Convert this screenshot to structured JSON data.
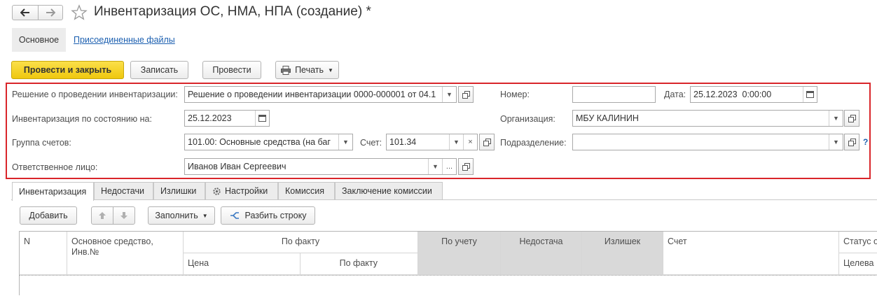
{
  "window": {
    "title": "Инвентаризация ОС, НМА, НПА (создание) *"
  },
  "nav": {
    "back_icon": "arrow-left-icon",
    "forward_icon": "arrow-right-icon",
    "favorite_icon": "star-icon"
  },
  "sections": {
    "main": "Основное",
    "files": "Присоединенные файлы"
  },
  "toolbar": {
    "post_close": "Провести и закрыть",
    "save": "Записать",
    "post": "Провести",
    "print": "Печать"
  },
  "form": {
    "decision_label": "Решение о проведении инвентаризации:",
    "decision_value": "Решение о проведении инвентаризации 0000-000001 от 04.1",
    "number_label": "Номер:",
    "number_value": "",
    "date_label": "Дата:",
    "date_value": "25.12.2023  0:00:00",
    "state_date_label": "Инвентаризация по состоянию на:",
    "state_date_value": "25.12.2023",
    "org_label": "Организация:",
    "org_value": "МБУ КАЛИНИН",
    "group_label": "Группа счетов:",
    "group_value": "101.00: Основные средства (на баг",
    "account_label": "Счет:",
    "account_value": "101.34",
    "division_label": "Подразделение:",
    "division_value": "",
    "responsible_label": "Ответственное лицо:",
    "responsible_value": "Иванов Иван Сергеевич",
    "help": "?"
  },
  "tabs": [
    "Инвентаризация",
    "Недостачи",
    "Излишки",
    "Настройки",
    "Комиссия",
    "Заключение комиссии"
  ],
  "table_toolbar": {
    "add": "Добавить",
    "fill": "Заполнить",
    "split": "Разбить строку"
  },
  "table": {
    "headers": {
      "n": "N",
      "asset": "Основное средство,",
      "asset2": "Инв.№",
      "fact": "По факту",
      "price": "Цена",
      "fact_sub": "По факту",
      "by_account": "По учету",
      "shortage": "Недостача",
      "surplus": "Излишек",
      "account": "Счет",
      "status": "Статус о",
      "target": "Целева"
    }
  },
  "colors": {
    "accent_yellow": "#f5d520",
    "highlight_red": "#d9252a",
    "link_blue": "#1b5fb0"
  }
}
